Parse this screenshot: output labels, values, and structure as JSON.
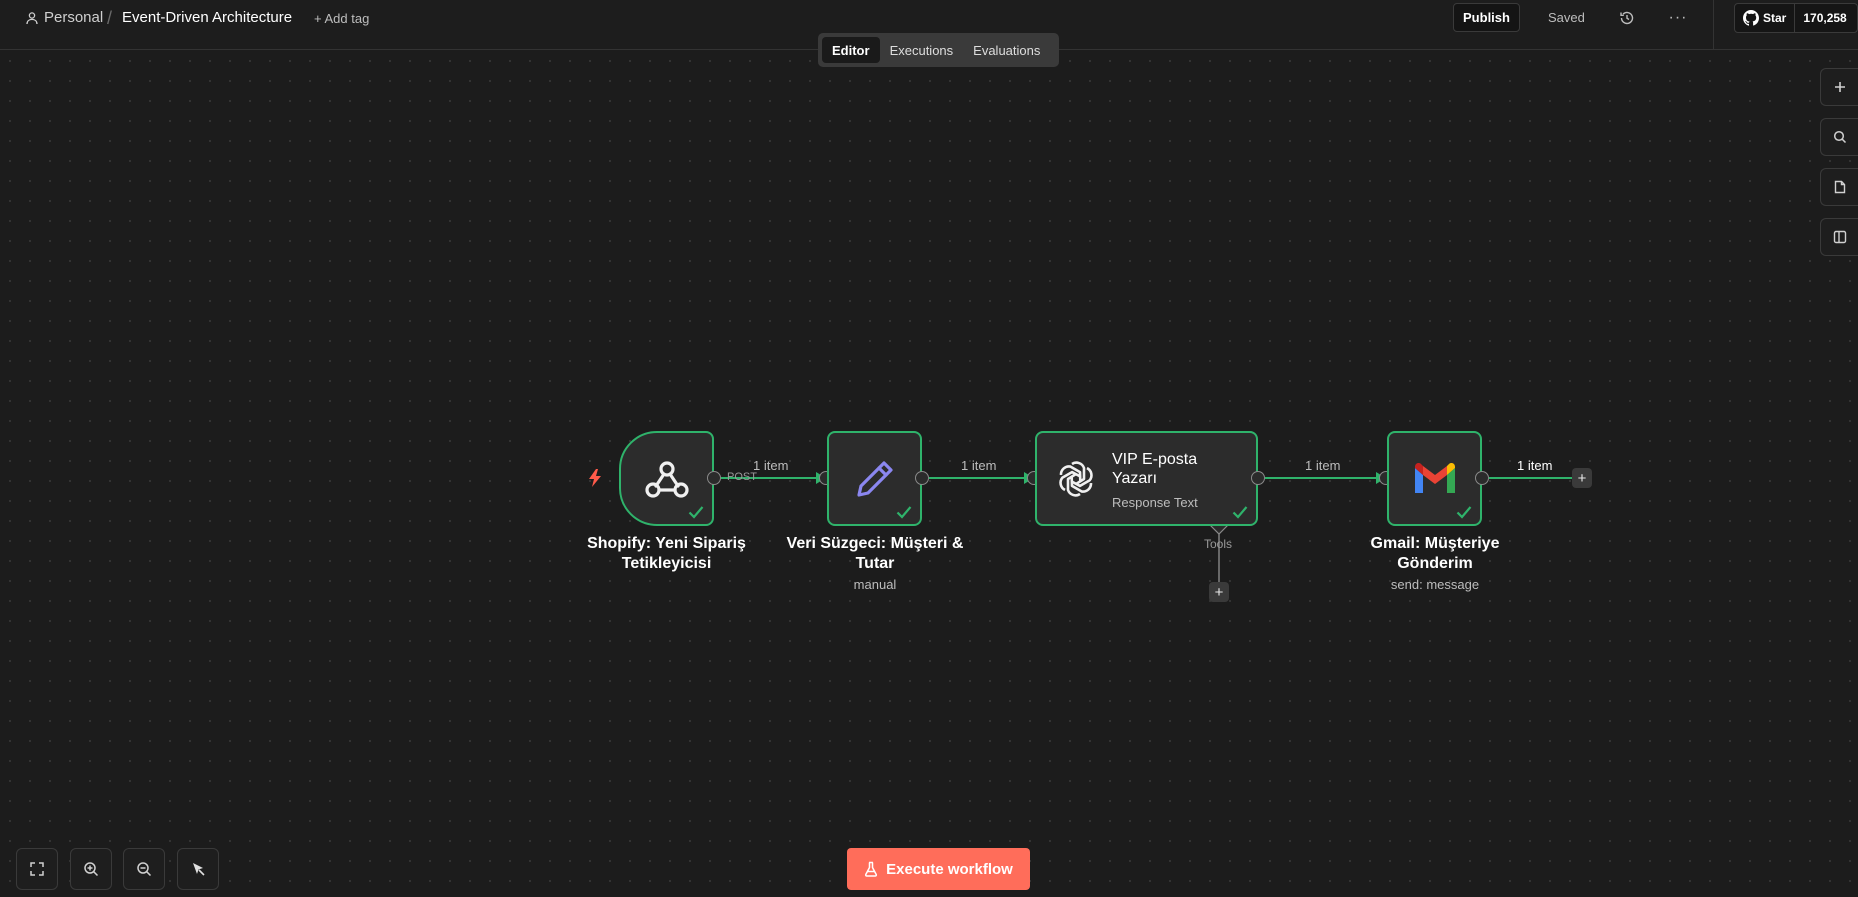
{
  "header": {
    "project": "Personal",
    "separator": "/",
    "workflow_title": "Event-Driven Architecture",
    "add_tag": "+ Add tag",
    "publish": "Publish",
    "saved": "Saved",
    "more": "···",
    "github_star": "Star",
    "github_count": "170,258"
  },
  "tabs": [
    {
      "label": "Editor",
      "active": true
    },
    {
      "label": "Executions",
      "active": false
    },
    {
      "label": "Evaluations",
      "active": false
    }
  ],
  "nodes": {
    "webhook": {
      "label_line1": "Shopify: Yeni Sipariş",
      "label_line2": "Tetikleyicisi",
      "icon": "webhook-icon"
    },
    "set": {
      "label_line1": "Veri Süzgeci: Müşteri &",
      "label_line2": "Tutar",
      "subtitle": "manual",
      "icon": "pencil-icon"
    },
    "ai": {
      "title": "VIP E-posta Yazarı",
      "subtitle": "Response Text",
      "tools_label": "Tools",
      "icon": "openai-icon"
    },
    "gmail": {
      "label_line1": "Gmail: Müşteriye",
      "label_line2": "Gönderim",
      "subtitle": "send: message",
      "icon": "gmail-icon"
    }
  },
  "edges": {
    "e1": "1 item",
    "e2": "1 item",
    "e3": "1 item",
    "e4": "1 item",
    "post": "POST"
  },
  "footer": {
    "execute": "Execute workflow"
  },
  "colors": {
    "success": "#2fb36b",
    "accent": "#ff6d5a",
    "background": "#1c1c1c"
  }
}
